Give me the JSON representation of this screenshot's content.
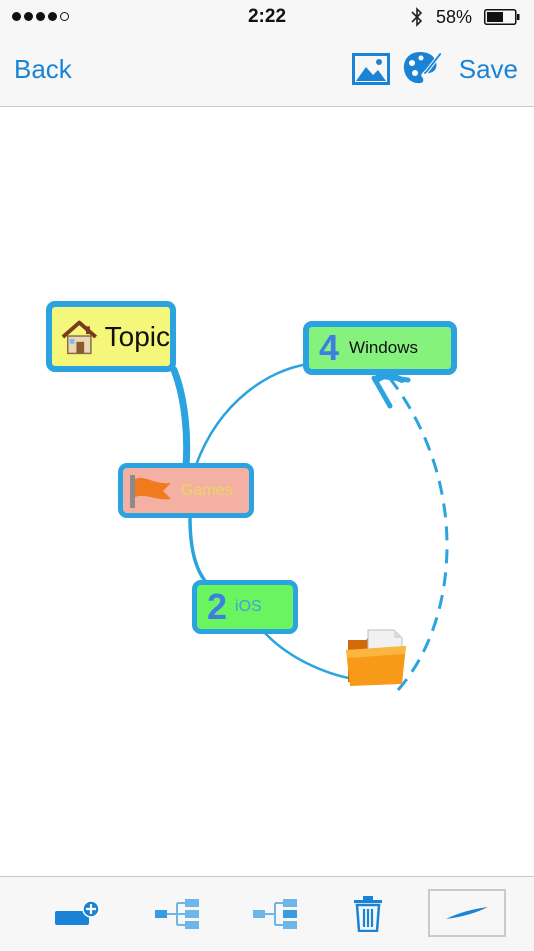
{
  "status": {
    "time": "2:22",
    "battery": "58%"
  },
  "nav": {
    "back_label": "Back",
    "save_label": "Save"
  },
  "nodes": {
    "topic": {
      "label": "Topic",
      "icon": "house-icon"
    },
    "games": {
      "label": "Games",
      "icon": "flag-icon"
    },
    "windows": {
      "label": "Windows",
      "number": "4"
    },
    "ios": {
      "label": "iOS",
      "number": "2"
    }
  },
  "toolbar": [
    "add-topic-icon",
    "add-child-icon",
    "add-sibling-icon",
    "trash-icon",
    "pen-icon"
  ],
  "colors": {
    "accent": "#1a83d6",
    "node_border": "#2aa3e0",
    "topic_fill": "#f5f77a",
    "games_fill": "#f5b0a4",
    "windows_fill": "#86f27e",
    "ios_fill": "#6af45f"
  }
}
